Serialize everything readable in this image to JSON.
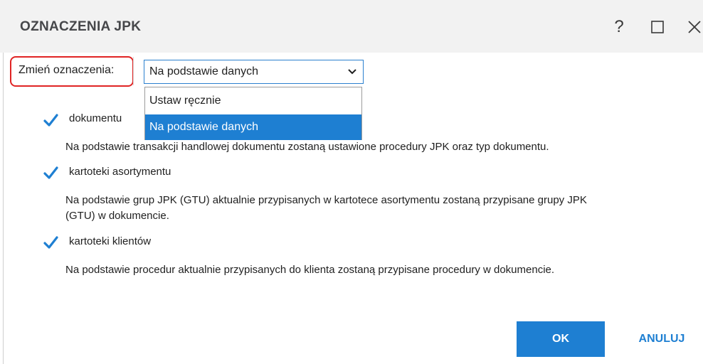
{
  "dialog": {
    "title": "OZNACZENIA JPK",
    "help_glyph": "?"
  },
  "change_marks": {
    "label": "Zmień oznaczenia:",
    "selected": "Na podstawie danych",
    "options": [
      "Ustaw ręcznie",
      "Na podstawie danych"
    ],
    "highlighted_index": 1
  },
  "options": [
    {
      "label": "dokumentu",
      "checked": true,
      "description": "Na podstawie transakcji handlowej dokumentu zostaną ustawione procedury JPK oraz typ dokumentu."
    },
    {
      "label": "kartoteki asortymentu",
      "checked": true,
      "description_line1": "Na podstawie grup JPK (GTU) aktualnie przypisanych w kartotece asortymentu zostaną przypisane grupy JPK",
      "description_line2": "(GTU) w dokumencie."
    },
    {
      "label": "kartoteki klientów",
      "checked": true,
      "description": "Na podstawie procedur aktualnie przypisanych do klienta zostaną przypisane procedury w dokumencie."
    }
  ],
  "buttons": {
    "ok": "OK",
    "cancel": "ANULUJ"
  },
  "colors": {
    "accent": "#1e7fd2",
    "highlight_border": "#e02424",
    "titlebar_bg": "#f2f2f2"
  }
}
